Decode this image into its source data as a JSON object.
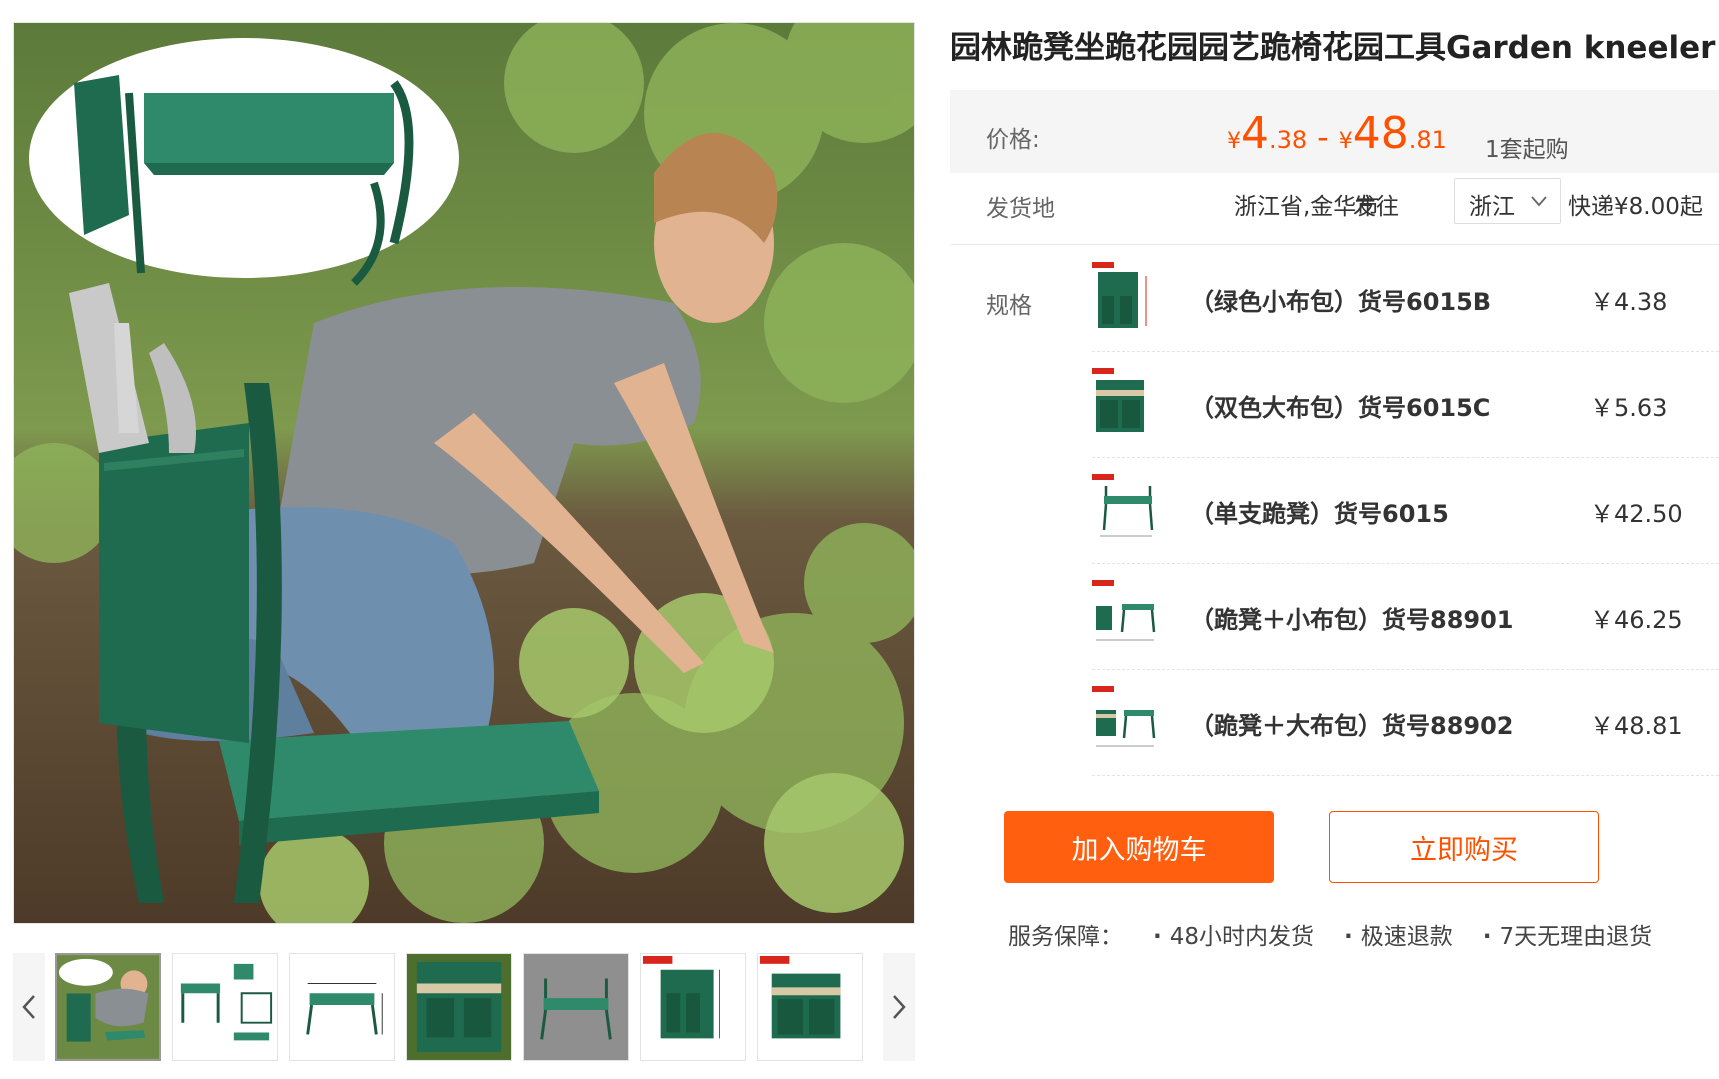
{
  "product": {
    "title": "园林跪凳坐跪花园园艺跪椅花园工具Garden kneeler"
  },
  "price": {
    "label": "价格:",
    "currency": "¥",
    "min_int": "4",
    "min_dec": ".38",
    "dash": "-",
    "max_int": "48",
    "max_dec": ".81",
    "min_order": "1套起购"
  },
  "shipping": {
    "label": "发货地",
    "from": "浙江省,金华市",
    "to_label": "发往",
    "province": "浙江",
    "express": "快递¥8.00起"
  },
  "specs": {
    "label": "规格",
    "items": [
      {
        "name": "（绿色小布包）货号6015B",
        "price": "￥4.38"
      },
      {
        "name": "（双色大布包）货号6015C",
        "price": "￥5.63"
      },
      {
        "name": "（单支跪凳）货号6015",
        "price": "￥42.50"
      },
      {
        "name": "（跪凳＋小布包）货号88901",
        "price": "￥46.25"
      },
      {
        "name": "（跪凳＋大布包）货号88902",
        "price": "￥48.81"
      }
    ]
  },
  "actions": {
    "add_to_cart": "加入购物车",
    "buy_now": "立即购买"
  },
  "service": {
    "label": "服务保障：",
    "items": [
      "48小时内发货",
      "极速退款",
      "7天无理由退货"
    ]
  },
  "colors": {
    "accent": "#ff5000",
    "cart_button": "#ff5f0f",
    "product_green": "#1f6b4f"
  }
}
